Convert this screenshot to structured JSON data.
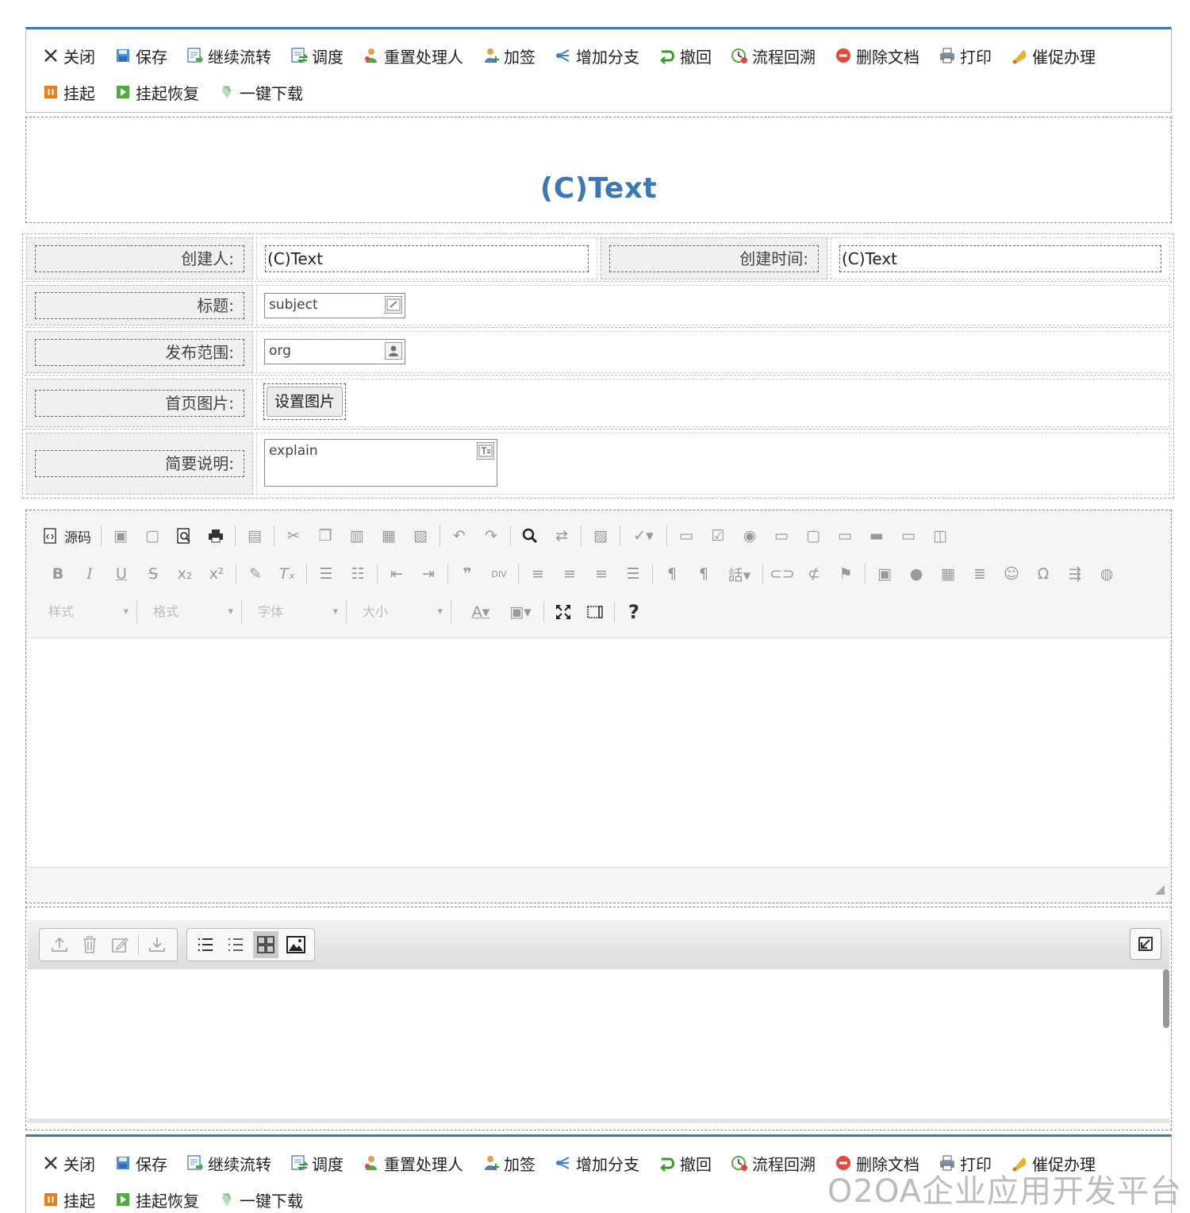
{
  "actions": [
    {
      "label": "关闭",
      "icon": "close-icon"
    },
    {
      "label": "保存",
      "icon": "save-icon"
    },
    {
      "label": "继续流转",
      "icon": "continue-flow-icon"
    },
    {
      "label": "调度",
      "icon": "dispatch-icon"
    },
    {
      "label": "重置处理人",
      "icon": "reset-handler-icon"
    },
    {
      "label": "加签",
      "icon": "add-signer-icon"
    },
    {
      "label": "增加分支",
      "icon": "add-branch-icon"
    },
    {
      "label": "撤回",
      "icon": "retract-icon"
    },
    {
      "label": "流程回溯",
      "icon": "flow-rollback-icon"
    },
    {
      "label": "删除文档",
      "icon": "delete-doc-icon"
    },
    {
      "label": "打印",
      "icon": "print-icon"
    },
    {
      "label": "催促办理",
      "icon": "urge-bell-icon"
    },
    {
      "label": "挂起",
      "icon": "pause-icon"
    },
    {
      "label": "挂起恢复",
      "icon": "resume-icon"
    },
    {
      "label": "一键下载",
      "icon": "download-icon"
    }
  ],
  "doc": {
    "title": "(C)Text"
  },
  "form": {
    "creator_label": "创建人:",
    "creator_value": "(C)Text",
    "created_time_label": "创建时间:",
    "created_time_value": "(C)Text",
    "subject_label": "标题:",
    "subject_value": "subject",
    "scope_label": "发布范围:",
    "scope_value": "org",
    "image_label": "首页图片:",
    "image_button": "设置图片",
    "explain_label": "简要说明:",
    "explain_value": "explain"
  },
  "editor": {
    "source_label": "源码",
    "style_combo": "样式",
    "format_combo": "格式",
    "font_combo": "字体",
    "size_combo": "大小",
    "help_label": "?"
  },
  "watermark": "O2OA企业应用开发平台"
}
